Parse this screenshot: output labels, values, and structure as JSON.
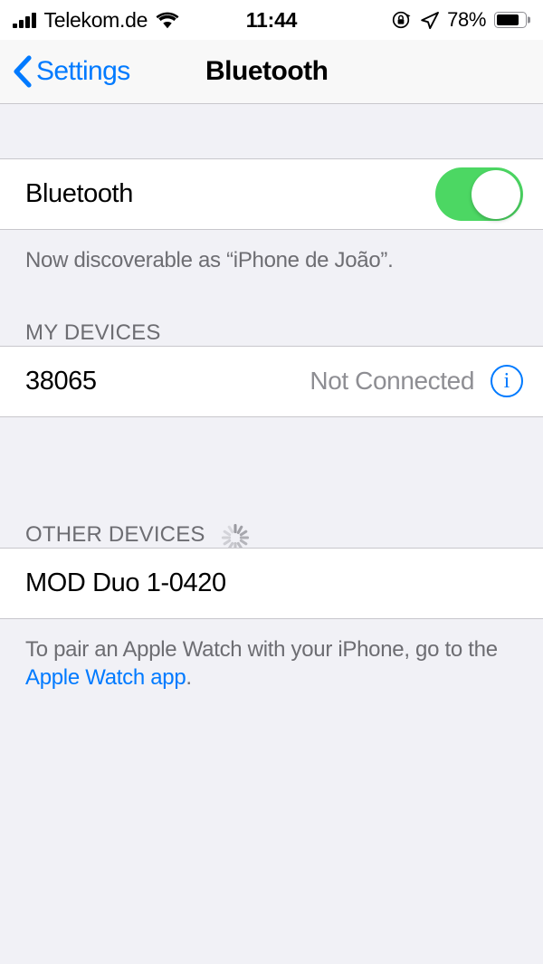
{
  "status_bar": {
    "carrier": "Telekom.de",
    "time": "11:44",
    "battery_percent": "78%",
    "battery_level": 78,
    "signal_bars": 4,
    "icons": [
      "signal-bars-icon",
      "wifi-icon",
      "rotation-lock-icon",
      "location-arrow-icon",
      "battery-icon"
    ]
  },
  "nav": {
    "back_label": "Settings",
    "title": "Bluetooth"
  },
  "bluetooth": {
    "label": "Bluetooth",
    "enabled": true,
    "toggle_on_color": "#4CD763",
    "discoverable_note": "Now discoverable as “iPhone de João”."
  },
  "my_devices": {
    "header": "MY DEVICES",
    "items": [
      {
        "name": "38065",
        "status": "Not Connected",
        "info_icon": "info-circle-icon"
      }
    ]
  },
  "other_devices": {
    "header": "OTHER DEVICES",
    "scanning": true,
    "items": [
      {
        "name": "MOD Duo 1-0420"
      }
    ]
  },
  "footer": {
    "text_before": "To pair an Apple Watch with your iPhone, go to the ",
    "link_text": "Apple Watch app",
    "text_after": "."
  },
  "colors": {
    "accent_blue": "#007AFF",
    "toggle_green": "#4CD763",
    "secondary_text": "#8E8E93",
    "group_background": "#F1F1F6"
  }
}
